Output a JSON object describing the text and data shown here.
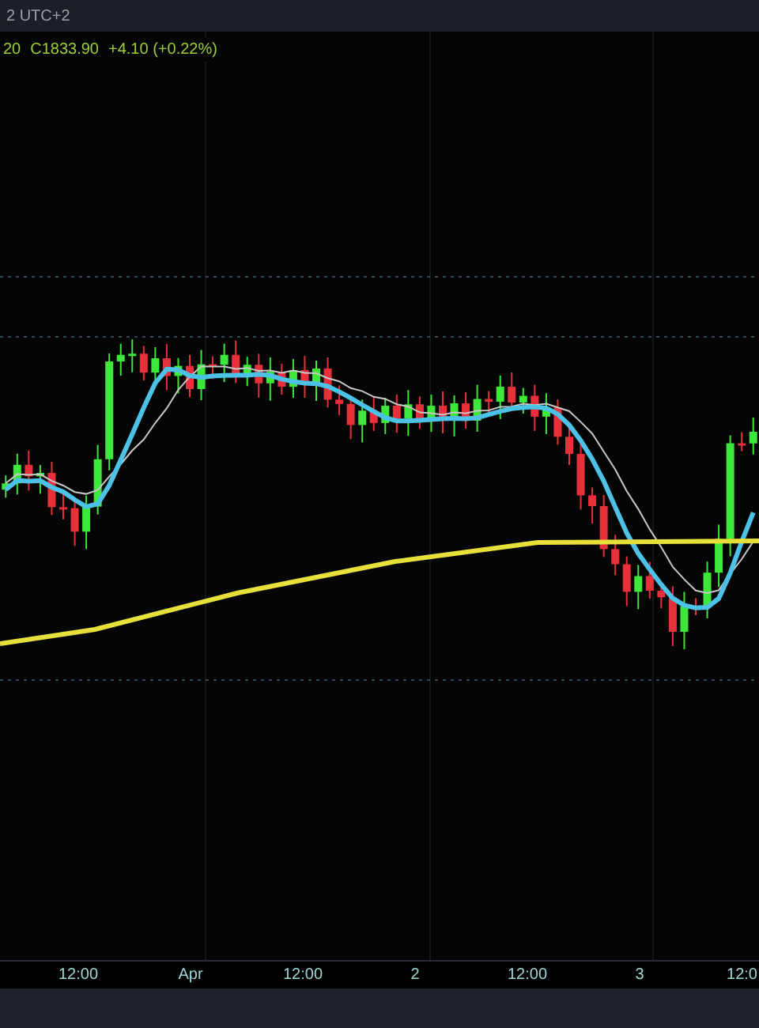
{
  "header": {
    "timezone": "2 UTC+2"
  },
  "legend": {
    "open": "20",
    "close": "C1833.90",
    "change": "+4.10 (+0.22%)"
  },
  "time_axis": [
    "12:00",
    "Apr",
    "12:00",
    "2",
    "12:00",
    "3",
    "12:0"
  ]
}
